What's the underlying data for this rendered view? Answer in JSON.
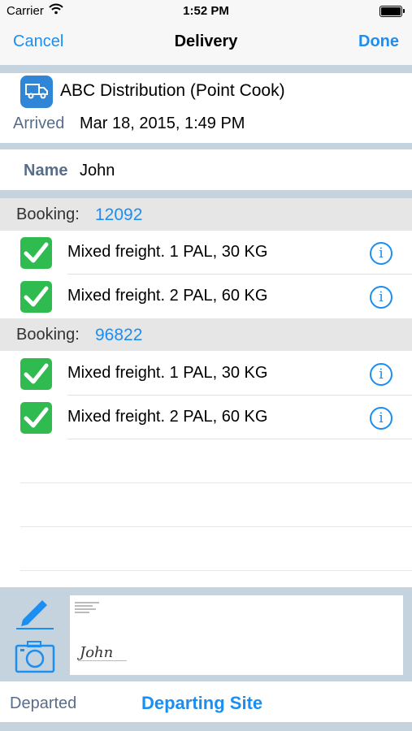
{
  "status": {
    "carrier": "Carrier",
    "time": "1:52 PM"
  },
  "nav": {
    "cancel": "Cancel",
    "title": "Delivery",
    "done": "Done"
  },
  "site": {
    "name": "ABC Distribution (Point Cook)",
    "arrived_label": "Arrived",
    "arrived_value": "Mar 18, 2015, 1:49 PM"
  },
  "contact": {
    "name_label": "Name",
    "name_value": "John"
  },
  "bookings": [
    {
      "label": "Booking:",
      "number": "12092",
      "items": [
        {
          "description": "Mixed freight. 1 PAL, 30 KG",
          "checked": true
        },
        {
          "description": "Mixed freight. 2 PAL, 60 KG",
          "checked": true
        }
      ]
    },
    {
      "label": "Booking:",
      "number": "96822",
      "items": [
        {
          "description": "Mixed freight. 1 PAL, 30 KG",
          "checked": true
        },
        {
          "description": "Mixed freight. 2 PAL, 60 KG",
          "checked": true
        }
      ]
    }
  ],
  "signature": {
    "signed_name": "John"
  },
  "footer": {
    "departed": "Departed",
    "departing_site": "Departing Site"
  },
  "icons": {
    "site": "truck-icon",
    "item": "checkmark-icon",
    "detail": "info-icon",
    "sign": "pencil-icon",
    "photo": "camera-icon"
  },
  "colors": {
    "accent": "#1b8ef2",
    "check": "#2fbb4f",
    "band": "#c5d3de",
    "label": "#586d8a"
  }
}
